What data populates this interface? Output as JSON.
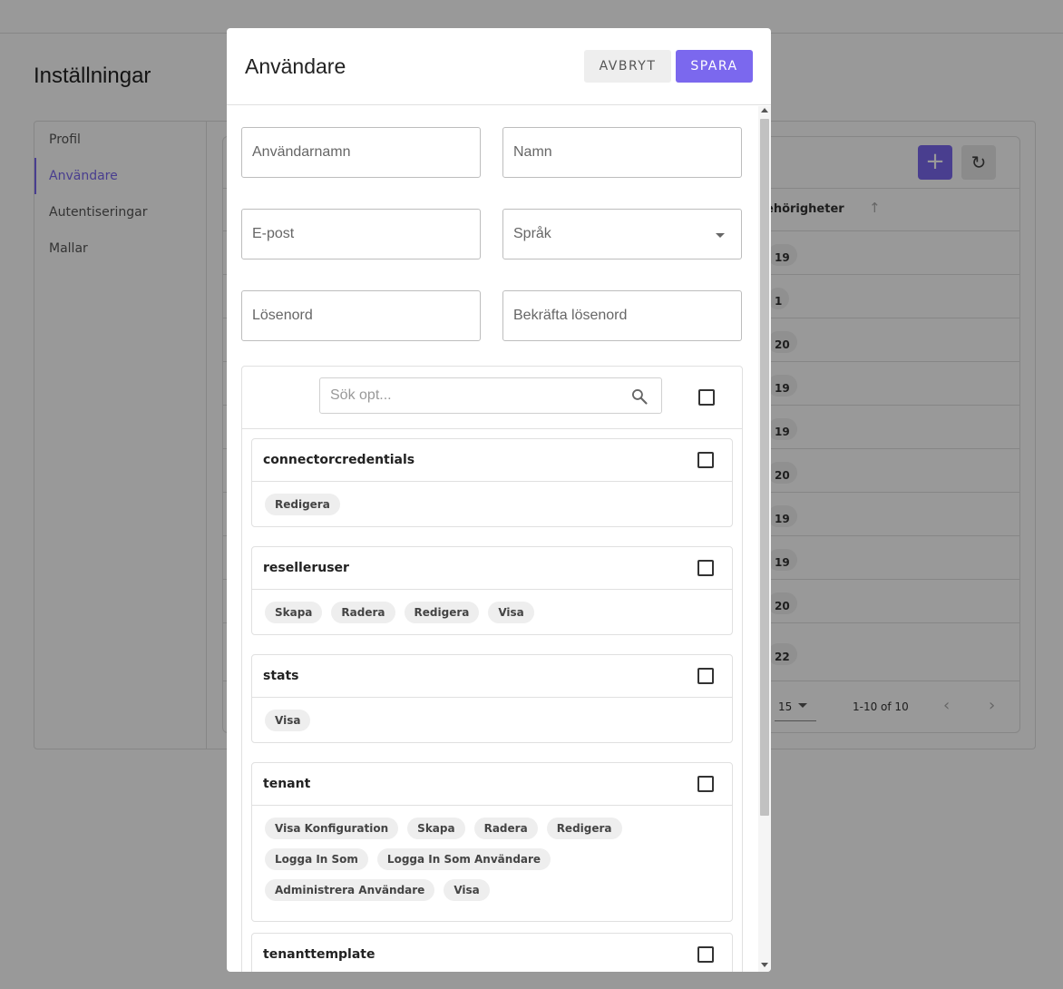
{
  "page": {
    "title": "Inställningar",
    "nav": [
      {
        "label": "Profil"
      },
      {
        "label": "Användare"
      },
      {
        "label": "Autentiseringar"
      },
      {
        "label": "Mallar"
      }
    ],
    "table": {
      "column_label": "ehörigheter",
      "values": [
        "19",
        "1",
        "20",
        "19",
        "19",
        "20",
        "19",
        "19",
        "20",
        "22"
      ],
      "rows_per_page": "15",
      "range": "1-10 of 10"
    }
  },
  "modal": {
    "title": "Användare",
    "cancel_label": "AVBRYT",
    "save_label": "SPARA",
    "fields": {
      "username": "Användarnamn",
      "name": "Namn",
      "email": "E-post",
      "language": "Språk",
      "password": "Lösenord",
      "confirm_password": "Bekräfta lösenord"
    },
    "search_placeholder": "Sök opt...",
    "groups": [
      {
        "name": "connectorcredentials",
        "perms": [
          "Redigera"
        ]
      },
      {
        "name": "reselleruser",
        "perms": [
          "Skapa",
          "Radera",
          "Redigera",
          "Visa"
        ]
      },
      {
        "name": "stats",
        "perms": [
          "Visa"
        ]
      },
      {
        "name": "tenant",
        "perms": [
          "Visa Konfiguration",
          "Skapa",
          "Radera",
          "Redigera",
          "Logga In Som",
          "Logga In Som Användare",
          "Administrera Användare",
          "Visa"
        ]
      },
      {
        "name": "tenanttemplate",
        "perms": []
      }
    ]
  }
}
